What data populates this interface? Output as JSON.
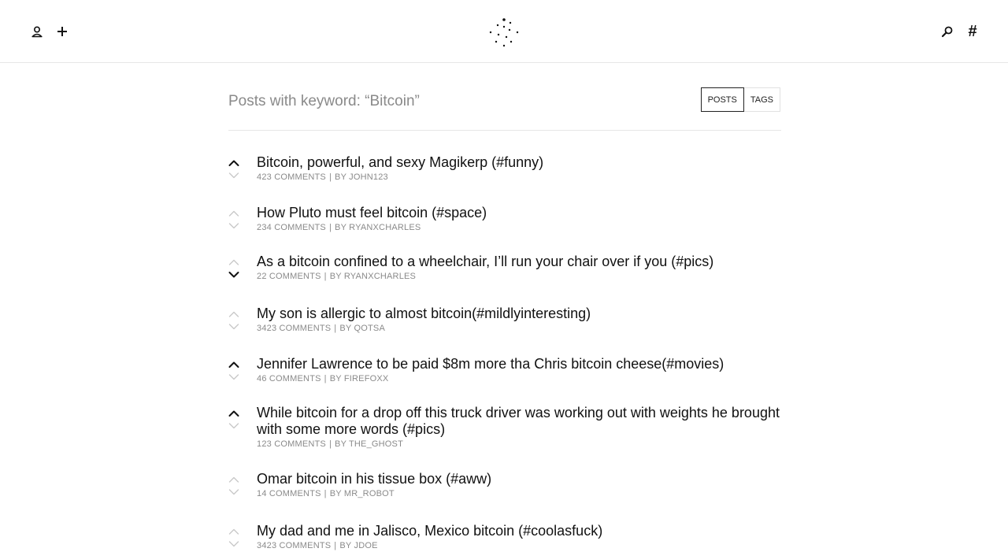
{
  "header": {
    "icons": [
      "user-icon",
      "plus-icon",
      "search-icon",
      "hash-icon"
    ],
    "hash_symbol": "#"
  },
  "page": {
    "title": "Posts with keyword: “Bitcoin”",
    "toggle": {
      "posts": "POSTS",
      "tags": "TAGS",
      "active": "posts"
    }
  },
  "posts": [
    {
      "title": "Bitcoin, powerful, and sexy Magikerp (#funny)",
      "comments": "423 COMMENTS",
      "author": "BY JOHN123",
      "vote": "up"
    },
    {
      "title": "How Pluto must feel bitcoin (#space)",
      "comments": "234 COMMENTS",
      "author": "BY RYANXCHARLES",
      "vote": "none"
    },
    {
      "title": "As a bitcoin confined to a wheelchair, I’ll run your chair over if you (#pics)",
      "comments": "22 COMMENTS",
      "author": "BY RYANXCHARLES",
      "vote": "down"
    },
    {
      "title": "My son is allergic to almost bitcoin(#mildlyinteresting)",
      "comments": "3423 COMMENTS",
      "author": "BY QOTSA",
      "vote": "none"
    },
    {
      "title": "Jennifer Lawrence to be paid $8m more tha Chris bitcoin cheese(#movies)",
      "comments": "46 COMMENTS",
      "author": "BY FIREFOXX",
      "vote": "up"
    },
    {
      "title": "While bitcoin for a drop off this truck driver was working out with weights he brought with some more words (#pics)",
      "comments": "123 COMMENTS",
      "author": "BY THE_GHOST",
      "vote": "up"
    },
    {
      "title": "Omar bitcoin in his tissue box (#aww)",
      "comments": "14 COMMENTS",
      "author": "BY MR_ROBOT",
      "vote": "none"
    },
    {
      "title": "My dad and me in Jalisco, Mexico bitcoin (#coolasfuck)",
      "comments": "3423 COMMENTS",
      "author": "BY JDOE",
      "vote": "none"
    }
  ],
  "colors": {
    "text": "#111111",
    "muted": "#8a8a8a",
    "arrow_inactive": "#c8c8c8",
    "border": "#e6e6e6"
  }
}
